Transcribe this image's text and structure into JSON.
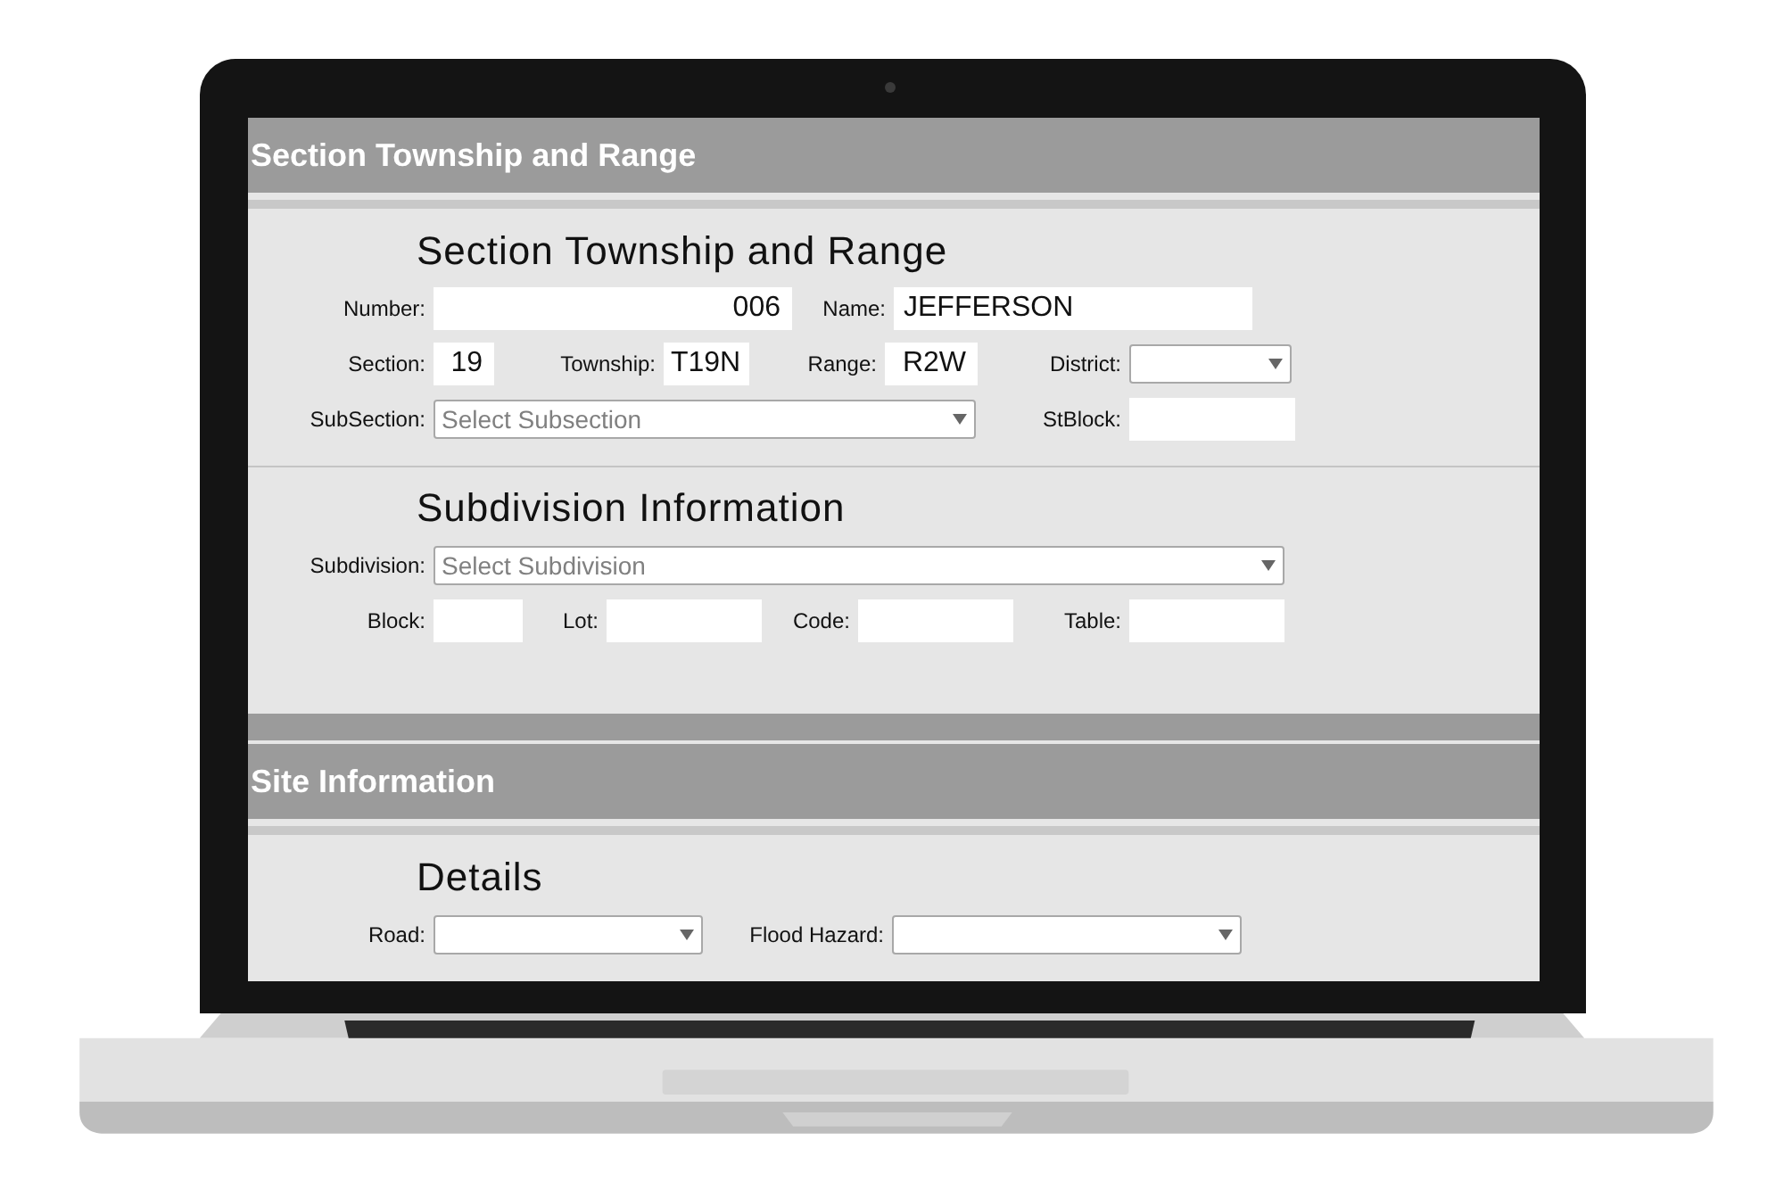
{
  "sections": [
    {
      "title": "Section Township and Range",
      "groups": [
        {
          "heading": "Section Township and Range",
          "rows": [
            {
              "fields": [
                {
                  "label": "Number:",
                  "kind": "text",
                  "value": "006"
                },
                {
                  "label": "Name:",
                  "kind": "text",
                  "value": "JEFFERSON"
                }
              ]
            },
            {
              "fields": [
                {
                  "label": "Section:",
                  "kind": "text",
                  "value": "19"
                },
                {
                  "label": "Township:",
                  "kind": "text",
                  "value": "T19N"
                },
                {
                  "label": "Range:",
                  "kind": "text",
                  "value": "R2W"
                },
                {
                  "label": "District:",
                  "kind": "select"
                }
              ]
            },
            {
              "fields": [
                {
                  "label": "SubSection:",
                  "kind": "select",
                  "placeholder": "Select Subsection"
                },
                {
                  "label": "StBlock:",
                  "kind": "text"
                }
              ]
            }
          ]
        },
        {
          "heading": "Subdivision Information",
          "rows": [
            {
              "fields": [
                {
                  "label": "Subdivision:",
                  "kind": "select",
                  "placeholder": "Select Subdivision"
                }
              ]
            },
            {
              "fields": [
                {
                  "label": "Block:",
                  "kind": "text"
                },
                {
                  "label": "Lot:",
                  "kind": "text"
                },
                {
                  "label": "Code:",
                  "kind": "text"
                },
                {
                  "label": "Table:",
                  "kind": "text"
                }
              ]
            }
          ]
        }
      ]
    },
    {
      "title": "Site Information",
      "groups": [
        {
          "heading": "Details",
          "rows": [
            {
              "fields": [
                {
                  "label": "Road:",
                  "kind": "select"
                },
                {
                  "label": "Flood Hazard:",
                  "kind": "select"
                }
              ]
            }
          ]
        }
      ]
    }
  ]
}
